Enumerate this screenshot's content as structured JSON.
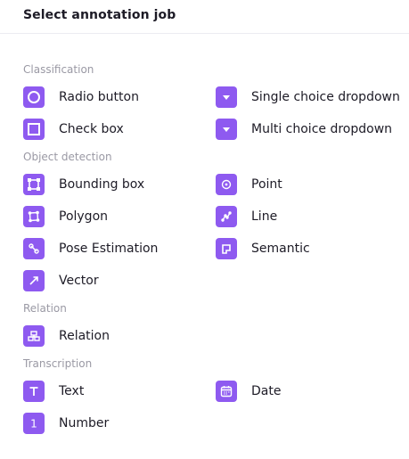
{
  "header": {
    "title": "Select annotation job"
  },
  "sections": {
    "classification": "Classification",
    "object_detection": "Object detection",
    "relation": "Relation",
    "transcription": "Transcription"
  },
  "items": {
    "radio_button": {
      "label": "Radio button",
      "icon": "radio-icon"
    },
    "single_choice_dropdown": {
      "label": "Single choice dropdown",
      "icon": "dropdown-icon"
    },
    "check_box": {
      "label": "Check box",
      "icon": "checkbox-icon"
    },
    "multi_choice_dropdown": {
      "label": "Multi choice dropdown",
      "icon": "dropdown-icon"
    },
    "bounding_box": {
      "label": "Bounding box",
      "icon": "bounding-box-icon"
    },
    "point": {
      "label": "Point",
      "icon": "point-icon"
    },
    "polygon": {
      "label": "Polygon",
      "icon": "polygon-icon"
    },
    "line": {
      "label": "Line",
      "icon": "line-icon"
    },
    "pose_estimation": {
      "label": "Pose Estimation",
      "icon": "pose-icon"
    },
    "semantic": {
      "label": "Semantic",
      "icon": "semantic-icon"
    },
    "vector": {
      "label": "Vector",
      "icon": "vector-icon"
    },
    "relation": {
      "label": "Relation",
      "icon": "relation-icon"
    },
    "text": {
      "label": "Text",
      "icon": "text-icon"
    },
    "date": {
      "label": "Date",
      "icon": "calendar-icon"
    },
    "number": {
      "label": "Number",
      "icon": "number-icon",
      "glyph": "1"
    }
  },
  "colors": {
    "accent": "#8e5af0",
    "section_label": "#9a99a4",
    "text": "#1d1b26",
    "divider": "#ececf1"
  }
}
